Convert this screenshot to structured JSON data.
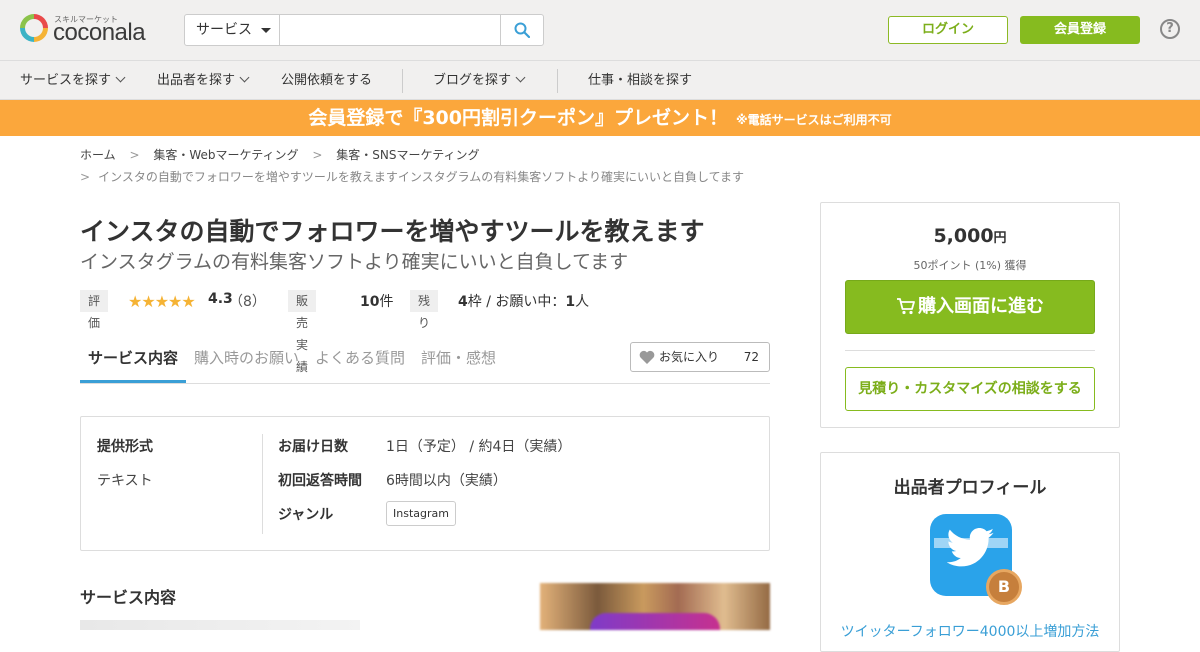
{
  "header": {
    "logo_sub": "スキルマーケット",
    "logo_text": "coconala",
    "search_category": "サービス",
    "search_placeholder": "",
    "login_label": "ログイン",
    "register_label": "会員登録",
    "help_label": "?"
  },
  "nav": {
    "items": [
      {
        "label": "サービスを探す",
        "dropdown": true
      },
      {
        "label": "出品者を探す",
        "dropdown": true
      },
      {
        "label": "公開依頼をする",
        "dropdown": false
      },
      {
        "label": "ブログを探す",
        "dropdown": true
      },
      {
        "label": "仕事・相談を探す",
        "dropdown": false
      }
    ]
  },
  "banner": {
    "main": "会員登録で『300円割引クーポン』プレゼント！",
    "note": "※電話サービスはご利用不可",
    "color": "#fba73c"
  },
  "breadcrumb": {
    "items": [
      "ホーム",
      "集客・Webマーケティング",
      "集客・SNSマーケティング"
    ],
    "current": "インスタの自動でフォロワーを増やすツールを教えますインスタグラムの有料集客ソフトより確実にいいと自負してます"
  },
  "service": {
    "title": "インスタの自動でフォロワーを増やすツールを教えます",
    "subtitle": "インスタグラムの有料集客ソフトより確実にいいと自負してます",
    "rating_label": "評価",
    "rating": "4.3",
    "rating_stars": 4.3,
    "review_count": "（8）",
    "sales_label": "販売実績",
    "sales_value": "10",
    "sales_unit": "件",
    "remaining_label": "残り",
    "remaining_value": "4",
    "remaining_text": "枠 / お願い中：",
    "in_progress_value": "1",
    "in_progress_unit": "人"
  },
  "tabs": {
    "items": [
      "サービス内容",
      "購入時のお願い",
      "よくある質問",
      "評価・感想"
    ],
    "active": "サービス内容",
    "favorite_label": "お気に入り",
    "favorite_count": "72"
  },
  "info": {
    "format_label": "提供形式",
    "format_value": "テキスト",
    "delivery_label": "お届け日数",
    "delivery_value": "1日（予定） / 約4日（実績）",
    "reply_label": "初回返答時間",
    "reply_value": "6時間以内（実績）",
    "genre_label": "ジャンル",
    "genre_value": "Instagram"
  },
  "section": {
    "title": "サービス内容"
  },
  "purchase": {
    "price": "5,000",
    "currency": "円",
    "points": "50ポイント (1%) 獲得",
    "buy_label": "購入画面に進む",
    "consult_label": "見積り・カスタマイズの相談をする",
    "accent_color": "#86bb1f"
  },
  "profile": {
    "title": "出品者プロフィール",
    "rank_badge": "B",
    "seller_name": "ツイッターフォロワー4000以上増加方法"
  }
}
